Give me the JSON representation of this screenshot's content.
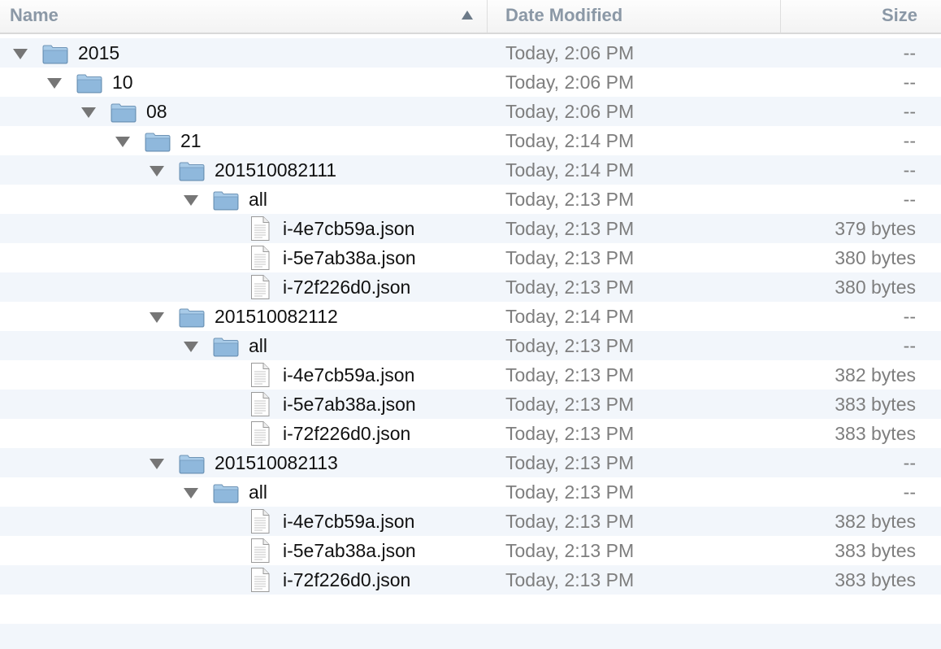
{
  "header": {
    "name_label": "Name",
    "date_label": "Date Modified",
    "size_label": "Size",
    "sort_indicator": "sort-ascending-icon"
  },
  "rows": [
    {
      "type": "folder",
      "level": 0,
      "name": "2015",
      "date": "Today, 2:06 PM",
      "size": "--"
    },
    {
      "type": "folder",
      "level": 1,
      "name": "10",
      "date": "Today, 2:06 PM",
      "size": "--"
    },
    {
      "type": "folder",
      "level": 2,
      "name": "08",
      "date": "Today, 2:06 PM",
      "size": "--"
    },
    {
      "type": "folder",
      "level": 3,
      "name": "21",
      "date": "Today, 2:14 PM",
      "size": "--"
    },
    {
      "type": "folder",
      "level": 4,
      "name": "201510082111",
      "date": "Today, 2:14 PM",
      "size": "--"
    },
    {
      "type": "folder",
      "level": 5,
      "name": "all",
      "date": "Today, 2:13 PM",
      "size": "--"
    },
    {
      "type": "file",
      "level": 6,
      "name": "i-4e7cb59a.json",
      "date": "Today, 2:13 PM",
      "size": "379 bytes"
    },
    {
      "type": "file",
      "level": 6,
      "name": "i-5e7ab38a.json",
      "date": "Today, 2:13 PM",
      "size": "380 bytes"
    },
    {
      "type": "file",
      "level": 6,
      "name": "i-72f226d0.json",
      "date": "Today, 2:13 PM",
      "size": "380 bytes"
    },
    {
      "type": "folder",
      "level": 4,
      "name": "201510082112",
      "date": "Today, 2:14 PM",
      "size": "--"
    },
    {
      "type": "folder",
      "level": 5,
      "name": "all",
      "date": "Today, 2:13 PM",
      "size": "--"
    },
    {
      "type": "file",
      "level": 6,
      "name": "i-4e7cb59a.json",
      "date": "Today, 2:13 PM",
      "size": "382 bytes"
    },
    {
      "type": "file",
      "level": 6,
      "name": "i-5e7ab38a.json",
      "date": "Today, 2:13 PM",
      "size": "383 bytes"
    },
    {
      "type": "file",
      "level": 6,
      "name": "i-72f226d0.json",
      "date": "Today, 2:13 PM",
      "size": "383 bytes"
    },
    {
      "type": "folder",
      "level": 4,
      "name": "201510082113",
      "date": "Today, 2:13 PM",
      "size": "--"
    },
    {
      "type": "folder",
      "level": 5,
      "name": "all",
      "date": "Today, 2:13 PM",
      "size": "--"
    },
    {
      "type": "file",
      "level": 6,
      "name": "i-4e7cb59a.json",
      "date": "Today, 2:13 PM",
      "size": "382 bytes"
    },
    {
      "type": "file",
      "level": 6,
      "name": "i-5e7ab38a.json",
      "date": "Today, 2:13 PM",
      "size": "383 bytes"
    },
    {
      "type": "file",
      "level": 6,
      "name": "i-72f226d0.json",
      "date": "Today, 2:13 PM",
      "size": "383 bytes"
    }
  ],
  "icons": {
    "folder": "folder-icon",
    "file": "document-icon",
    "disclosure": "disclosure-triangle-expanded-icon"
  },
  "colors": {
    "folder_fill": "#9fc3e2",
    "folder_stroke": "#6f94b6",
    "alt_row": "#f2f6fb",
    "header_text": "#8b98a6"
  }
}
